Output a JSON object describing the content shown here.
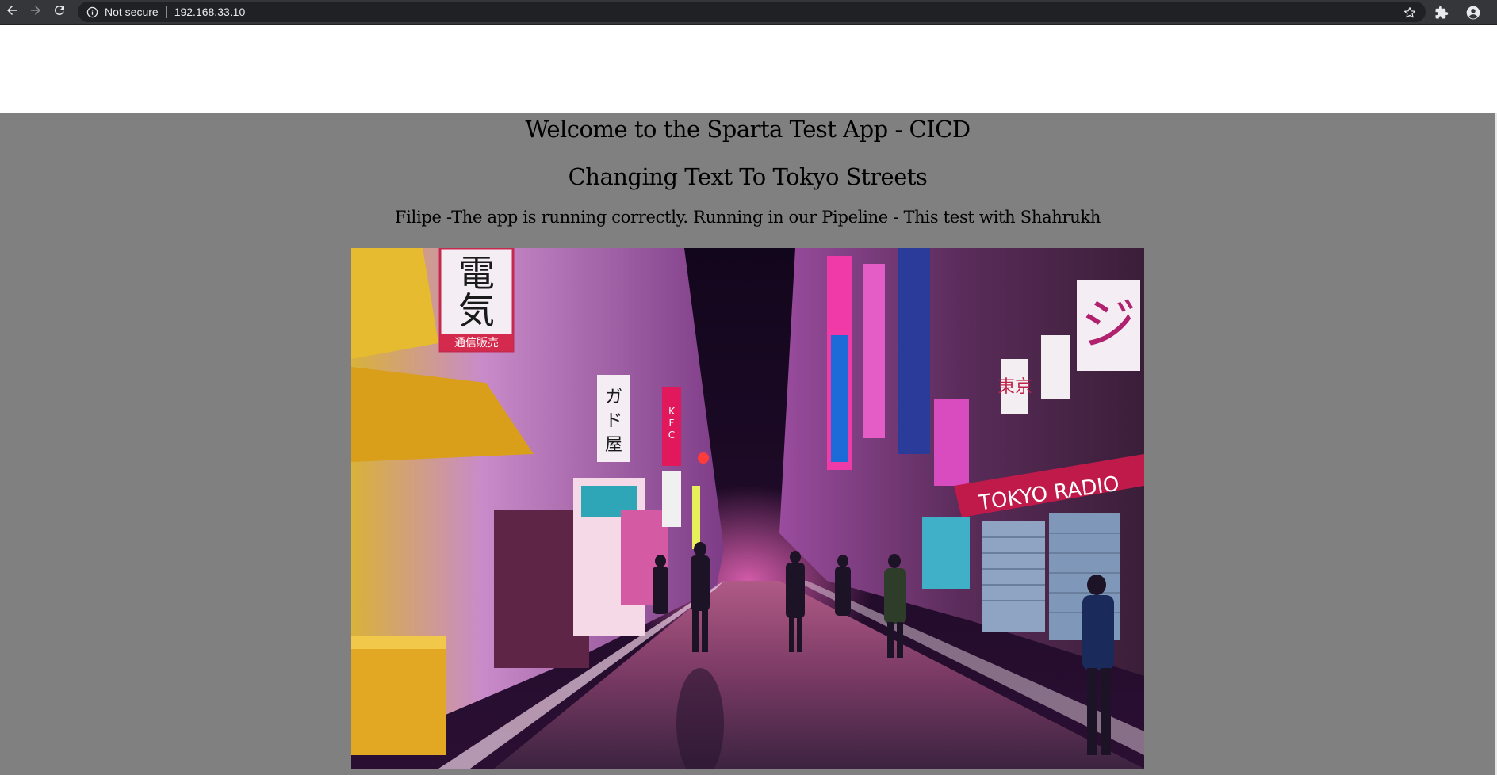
{
  "browser": {
    "security_label": "Not secure",
    "url": "192.168.33.10",
    "icons": {
      "back": "back-arrow-icon",
      "forward": "forward-arrow-icon",
      "reload": "reload-icon",
      "info": "info-icon",
      "bookmark": "star-icon",
      "extensions": "puzzle-icon",
      "profile": "account-icon"
    }
  },
  "page": {
    "title": "Welcome to the Sparta Test App - CICD",
    "subtitle": "Changing Text To Tokyo Streets",
    "status": "Filipe -The app is running correctly. Running in our Pipeline - This test with Shahrukh",
    "image_signs": {
      "kanji_top": "電気",
      "sign_red": "通信販売",
      "kfc": "KFC",
      "tokyo_radio": "TOKYO RADIO",
      "tokyo_kanji": "東京",
      "ji": "ジ"
    },
    "colors": {
      "background": "#808080",
      "text": "#000000"
    }
  }
}
